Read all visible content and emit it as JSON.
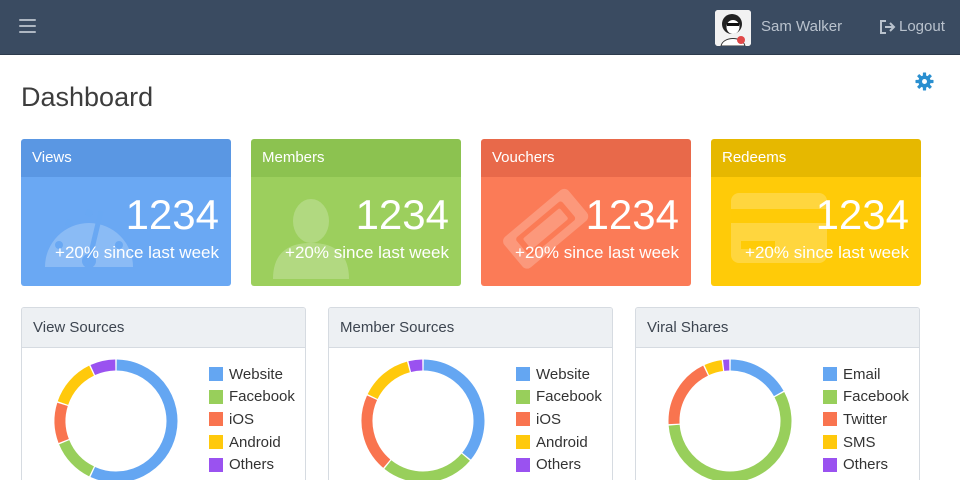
{
  "header": {
    "user_name": "Sam Walker",
    "logout_label": "Logout"
  },
  "page": {
    "title": "Dashboard"
  },
  "stats": [
    {
      "title": "Views",
      "value": "1234",
      "change": "+20% since last week",
      "color": "#6aa8f3",
      "icon": "speedometer-icon"
    },
    {
      "title": "Members",
      "value": "1234",
      "change": "+20% since last week",
      "color": "#9ccf5d",
      "icon": "user-icon"
    },
    {
      "title": "Vouchers",
      "value": "1234",
      "change": "+20% since last week",
      "color": "#fb7b57",
      "icon": "ticket-icon"
    },
    {
      "title": "Redeems",
      "value": "1234",
      "change": "+20% since last week",
      "color": "#ffcb08",
      "icon": "credit-card-icon"
    }
  ],
  "chart_data": [
    {
      "type": "pie",
      "title": "View Sources",
      "categories": [
        "Website",
        "Facebook",
        "iOS",
        "Android",
        "Others"
      ],
      "values": [
        57,
        12,
        11,
        13,
        7
      ],
      "colors": [
        "#64a6f2",
        "#98cf5b",
        "#f9744f",
        "#ffc90c",
        "#9a52f0"
      ]
    },
    {
      "type": "pie",
      "title": "Member Sources",
      "categories": [
        "Website",
        "Facebook",
        "iOS",
        "Android",
        "Others"
      ],
      "values": [
        36,
        25,
        21,
        14,
        4
      ],
      "colors": [
        "#64a6f2",
        "#98cf5b",
        "#f9744f",
        "#ffc90c",
        "#9a52f0"
      ]
    },
    {
      "type": "pie",
      "title": "Viral Shares",
      "categories": [
        "Email",
        "Facebook",
        "Twitter",
        "SMS",
        "Others"
      ],
      "values": [
        17,
        57,
        19,
        5,
        2
      ],
      "colors": [
        "#64a6f2",
        "#98cf5b",
        "#f9744f",
        "#ffc90c",
        "#9a52f0"
      ]
    }
  ]
}
